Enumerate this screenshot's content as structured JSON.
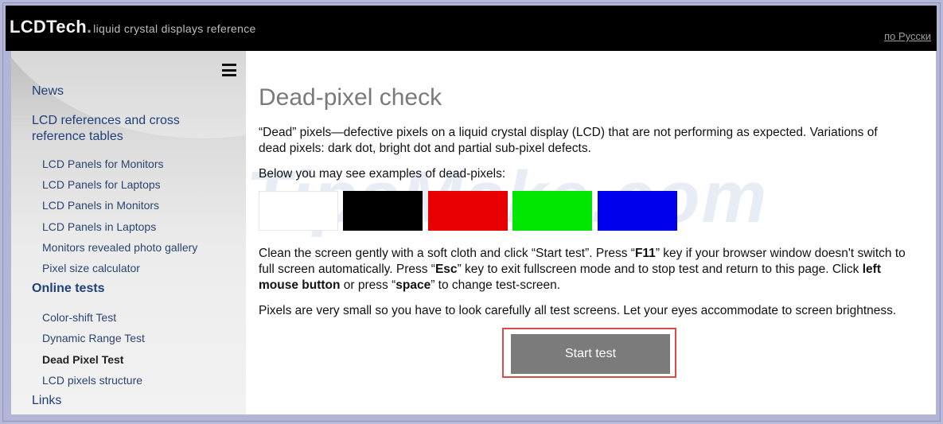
{
  "header": {
    "logo_main": "LCDTech",
    "logo_dot": ".",
    "logo_tagline": "liquid crystal displays reference",
    "language_link": "по Русски"
  },
  "sidebar": {
    "menu_icon": "hamburger-menu-icon",
    "items": [
      {
        "label": "News",
        "level": "main"
      },
      {
        "label": "LCD references and cross",
        "label2": "reference tables",
        "level": "main"
      },
      {
        "label": "LCD Panels for Monitors",
        "level": "sub"
      },
      {
        "label": "LCD Panels for Laptops",
        "level": "sub"
      },
      {
        "label": "LCD Panels in Monitors",
        "level": "sub"
      },
      {
        "label": "LCD Panels in Laptops",
        "level": "sub"
      },
      {
        "label": "Monitors revealed photo gallery",
        "level": "sub"
      },
      {
        "label": "Pixel size calculator",
        "level": "sub"
      },
      {
        "label": "Online tests",
        "level": "section"
      },
      {
        "label": "Color-shift Test",
        "level": "sub"
      },
      {
        "label": "Dynamic Range Test",
        "level": "sub"
      },
      {
        "label": "Dead Pixel Test",
        "level": "sub-current"
      },
      {
        "label": "LCD pixels structure",
        "level": "sub"
      },
      {
        "label": "Links",
        "level": "main"
      }
    ]
  },
  "main": {
    "title": "Dead-pixel check",
    "intro_line1": "“Dead” pixels—defective pixels on a liquid crystal display (LCD) that are not performing as expected. Variations of",
    "intro_line2": "dead pixels: dark dot, bright dot and partial sub-pixel defects.",
    "examples_label": "Below you may see examples of dead-pixels:",
    "swatch_colors": [
      "#ffffff",
      "#000000",
      "#e80000",
      "#00e600",
      "#0000ee"
    ],
    "instructions": {
      "t1": "Clean the screen gently with a soft cloth and click “Start test”. Press “",
      "k1": "F11",
      "t2": "” key if your browser window doesn't switch to full screen automatically. Press “",
      "k2": "Esc",
      "t3": "” key to exit fullscreen mode and to stop test and return to this page. Click ",
      "k3": "left mouse button",
      "t4": " or press “",
      "k4": "space",
      "t5": "” to change test-screen."
    },
    "note": "Pixels are very small so you have to look carefully all test screens. Let your eyes accommodate to screen brightness.",
    "start_button": "Start test",
    "watermark": "TipsMake.com"
  }
}
